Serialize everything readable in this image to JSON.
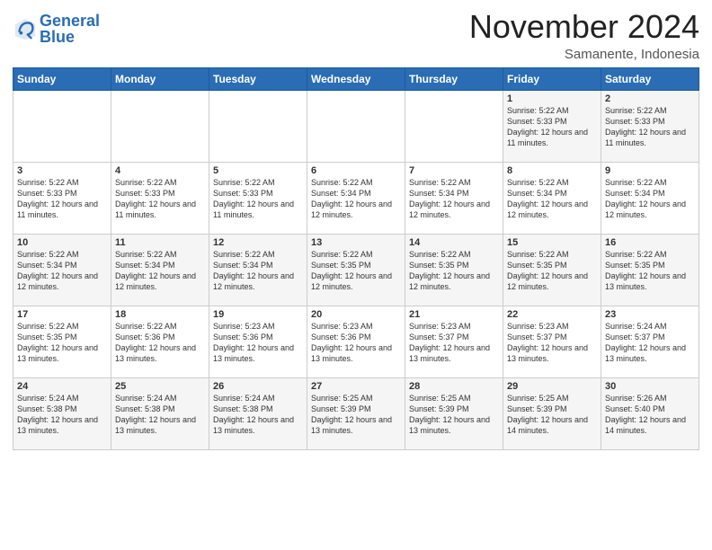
{
  "logo": {
    "line1": "General",
    "line2": "Blue"
  },
  "title": "November 2024",
  "location": "Samanente, Indonesia",
  "days_header": [
    "Sunday",
    "Monday",
    "Tuesday",
    "Wednesday",
    "Thursday",
    "Friday",
    "Saturday"
  ],
  "weeks": [
    [
      {
        "day": "",
        "text": ""
      },
      {
        "day": "",
        "text": ""
      },
      {
        "day": "",
        "text": ""
      },
      {
        "day": "",
        "text": ""
      },
      {
        "day": "",
        "text": ""
      },
      {
        "day": "1",
        "text": "Sunrise: 5:22 AM\nSunset: 5:33 PM\nDaylight: 12 hours and 11 minutes."
      },
      {
        "day": "2",
        "text": "Sunrise: 5:22 AM\nSunset: 5:33 PM\nDaylight: 12 hours and 11 minutes."
      }
    ],
    [
      {
        "day": "3",
        "text": "Sunrise: 5:22 AM\nSunset: 5:33 PM\nDaylight: 12 hours and 11 minutes."
      },
      {
        "day": "4",
        "text": "Sunrise: 5:22 AM\nSunset: 5:33 PM\nDaylight: 12 hours and 11 minutes."
      },
      {
        "day": "5",
        "text": "Sunrise: 5:22 AM\nSunset: 5:33 PM\nDaylight: 12 hours and 11 minutes."
      },
      {
        "day": "6",
        "text": "Sunrise: 5:22 AM\nSunset: 5:34 PM\nDaylight: 12 hours and 12 minutes."
      },
      {
        "day": "7",
        "text": "Sunrise: 5:22 AM\nSunset: 5:34 PM\nDaylight: 12 hours and 12 minutes."
      },
      {
        "day": "8",
        "text": "Sunrise: 5:22 AM\nSunset: 5:34 PM\nDaylight: 12 hours and 12 minutes."
      },
      {
        "day": "9",
        "text": "Sunrise: 5:22 AM\nSunset: 5:34 PM\nDaylight: 12 hours and 12 minutes."
      }
    ],
    [
      {
        "day": "10",
        "text": "Sunrise: 5:22 AM\nSunset: 5:34 PM\nDaylight: 12 hours and 12 minutes."
      },
      {
        "day": "11",
        "text": "Sunrise: 5:22 AM\nSunset: 5:34 PM\nDaylight: 12 hours and 12 minutes."
      },
      {
        "day": "12",
        "text": "Sunrise: 5:22 AM\nSunset: 5:34 PM\nDaylight: 12 hours and 12 minutes."
      },
      {
        "day": "13",
        "text": "Sunrise: 5:22 AM\nSunset: 5:35 PM\nDaylight: 12 hours and 12 minutes."
      },
      {
        "day": "14",
        "text": "Sunrise: 5:22 AM\nSunset: 5:35 PM\nDaylight: 12 hours and 12 minutes."
      },
      {
        "day": "15",
        "text": "Sunrise: 5:22 AM\nSunset: 5:35 PM\nDaylight: 12 hours and 12 minutes."
      },
      {
        "day": "16",
        "text": "Sunrise: 5:22 AM\nSunset: 5:35 PM\nDaylight: 12 hours and 13 minutes."
      }
    ],
    [
      {
        "day": "17",
        "text": "Sunrise: 5:22 AM\nSunset: 5:35 PM\nDaylight: 12 hours and 13 minutes."
      },
      {
        "day": "18",
        "text": "Sunrise: 5:22 AM\nSunset: 5:36 PM\nDaylight: 12 hours and 13 minutes."
      },
      {
        "day": "19",
        "text": "Sunrise: 5:23 AM\nSunset: 5:36 PM\nDaylight: 12 hours and 13 minutes."
      },
      {
        "day": "20",
        "text": "Sunrise: 5:23 AM\nSunset: 5:36 PM\nDaylight: 12 hours and 13 minutes."
      },
      {
        "day": "21",
        "text": "Sunrise: 5:23 AM\nSunset: 5:37 PM\nDaylight: 12 hours and 13 minutes."
      },
      {
        "day": "22",
        "text": "Sunrise: 5:23 AM\nSunset: 5:37 PM\nDaylight: 12 hours and 13 minutes."
      },
      {
        "day": "23",
        "text": "Sunrise: 5:24 AM\nSunset: 5:37 PM\nDaylight: 12 hours and 13 minutes."
      }
    ],
    [
      {
        "day": "24",
        "text": "Sunrise: 5:24 AM\nSunset: 5:38 PM\nDaylight: 12 hours and 13 minutes."
      },
      {
        "day": "25",
        "text": "Sunrise: 5:24 AM\nSunset: 5:38 PM\nDaylight: 12 hours and 13 minutes."
      },
      {
        "day": "26",
        "text": "Sunrise: 5:24 AM\nSunset: 5:38 PM\nDaylight: 12 hours and 13 minutes."
      },
      {
        "day": "27",
        "text": "Sunrise: 5:25 AM\nSunset: 5:39 PM\nDaylight: 12 hours and 13 minutes."
      },
      {
        "day": "28",
        "text": "Sunrise: 5:25 AM\nSunset: 5:39 PM\nDaylight: 12 hours and 13 minutes."
      },
      {
        "day": "29",
        "text": "Sunrise: 5:25 AM\nSunset: 5:39 PM\nDaylight: 12 hours and 14 minutes."
      },
      {
        "day": "30",
        "text": "Sunrise: 5:26 AM\nSunset: 5:40 PM\nDaylight: 12 hours and 14 minutes."
      }
    ]
  ]
}
